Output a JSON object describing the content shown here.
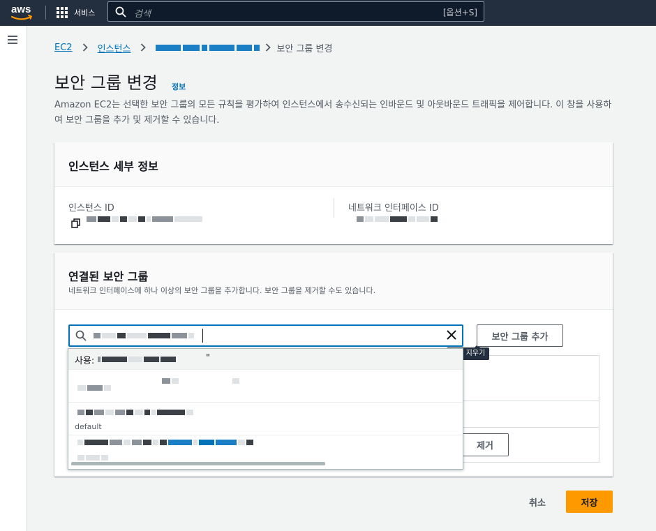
{
  "topnav": {
    "logo_text": "aws",
    "services_label": "서비스",
    "search_placeholder": "검색",
    "search_shortcut": "[옵션+S]"
  },
  "breadcrumb": {
    "items": [
      "EC2",
      "인스턴스"
    ],
    "current": "보안 그룹 변경"
  },
  "page": {
    "title": "보안 그룹 변경",
    "info_link": "정보",
    "description": "Amazon EC2는 선택한 보안 그룹의 모든 규칙을 평가하여 인스턴스에서 송수신되는 인바운드 및 아웃바운드 트래픽을 제어합니다. 이 창을 사용하여 보안 그룹을 추가 및 제거할 수 있습니다."
  },
  "instance_details": {
    "heading": "인스턴스 세부 정보",
    "instance_id_label": "인스턴스 ID",
    "network_interface_label": "네트워크 인터페이스 ID"
  },
  "security_groups": {
    "heading": "연결된 보안 그룹",
    "subtitle": "네트워크 인터페이스에 하나 이상의 보안 그룹을 추가합니다. 보안 그룹을 제거할 수도 있습니다.",
    "add_button": "보안 그룹 추가",
    "clear_tooltip": "선택 지우기",
    "remove_button": "제거"
  },
  "dropdown": {
    "use_prefix": "사용: \"",
    "use_suffix": "\"",
    "default_tag": "default"
  },
  "footer": {
    "cancel": "취소",
    "save": "저장"
  },
  "colors": {
    "nav_bg": "#232f3e",
    "link": "#0073bb",
    "primary": "#ff9900"
  }
}
